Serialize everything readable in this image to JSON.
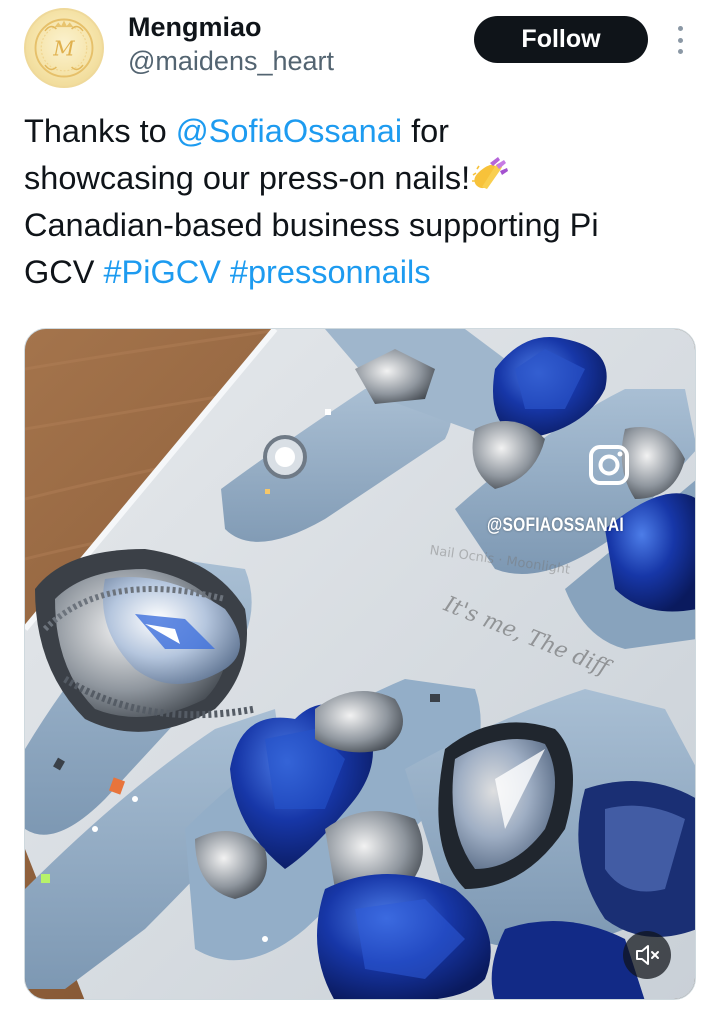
{
  "author": {
    "display_name": "Mengmiao",
    "handle": "@maidens_heart",
    "avatar_monogram": "M"
  },
  "actions": {
    "follow_label": "Follow",
    "more_icon": "more-vertical-icon"
  },
  "tweet": {
    "line1": {
      "pre": "Thanks to ",
      "mention": "@SofiaOssanai",
      "post": " for"
    },
    "line2": {
      "text": "showcasing our press-on nails!",
      "emoji": "nail-polish-emoji"
    },
    "line3": {
      "text": "Canadian-based business supporting Pi"
    },
    "line4": {
      "pre": "GCV ",
      "hashtag1": "#PiGCV",
      "sep": " ",
      "hashtag2": "#pressonnails"
    }
  },
  "media": {
    "type": "video",
    "watermark_handle": "@SOFIAOSSANAI",
    "watermark_sub": "Nail Ocnis · Moonlight",
    "watermark_script": "It's me, The diff",
    "instagram_icon": "instagram-icon",
    "mute_icon": "volume-muted-icon"
  },
  "colors": {
    "text": "#0f1419",
    "secondary": "#536471",
    "link": "#1d9bf0",
    "follow_bg": "#0f1419"
  }
}
